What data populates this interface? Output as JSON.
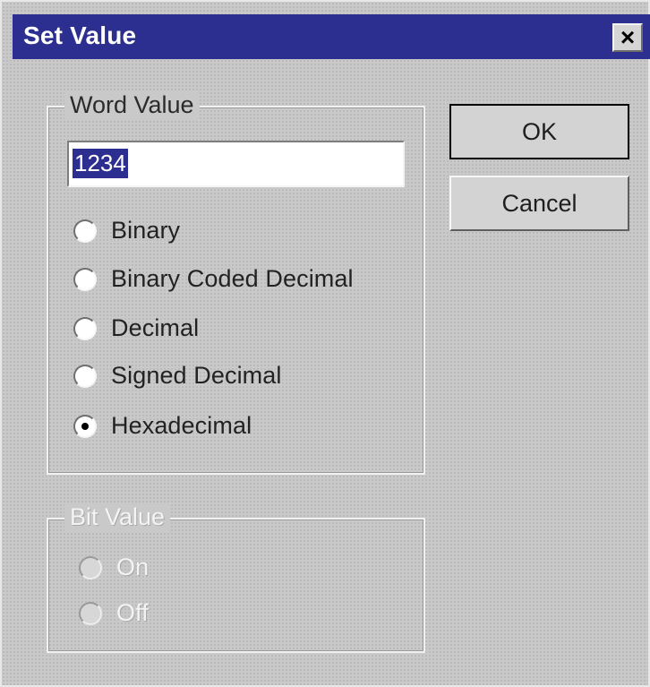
{
  "window": {
    "title": "Set Value",
    "close_glyph": "×"
  },
  "word_value": {
    "group_label": "Word Value",
    "input_value": "1234",
    "options": [
      {
        "label": "Binary",
        "checked": false
      },
      {
        "label": "Binary Coded Decimal",
        "checked": false
      },
      {
        "label": "Decimal",
        "checked": false
      },
      {
        "label": "Signed Decimal",
        "checked": false
      },
      {
        "label": "Hexadecimal",
        "checked": true
      }
    ]
  },
  "bit_value": {
    "group_label": "Bit Value",
    "options": [
      {
        "label": "On",
        "checked": false
      },
      {
        "label": "Off",
        "checked": false
      }
    ]
  },
  "buttons": {
    "ok_label": "OK",
    "cancel_label": "Cancel"
  }
}
